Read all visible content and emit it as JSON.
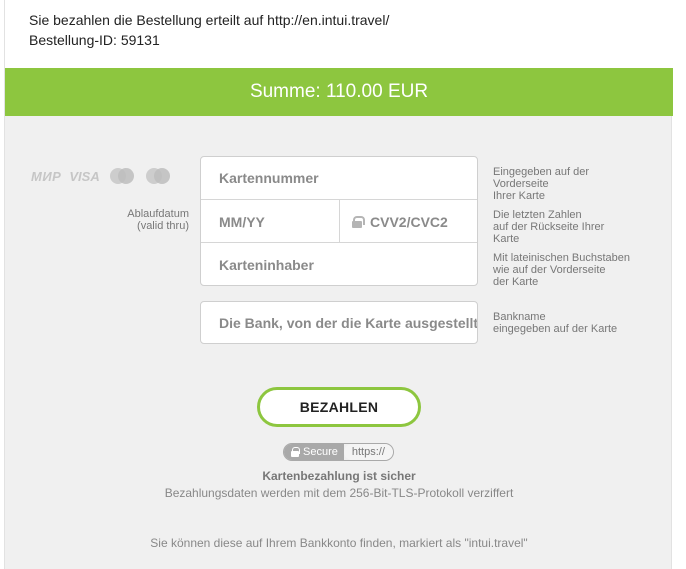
{
  "header": {
    "line1": "Sie bezahlen die Bestellung erteilt auf http://en.intui.travel/",
    "line2": "Bestellung-ID: 59131"
  },
  "total": {
    "label": "Summe: 110.00 EUR",
    "bar_color": "#8dc63f"
  },
  "card_logos": {
    "mir": "МИР",
    "visa": "VISA",
    "icons": [
      "mastercard-icon",
      "maestro-icon"
    ]
  },
  "expiry_label": {
    "line1": "Ablaufdatum",
    "line2": "(valid thru)"
  },
  "form": {
    "card_number_placeholder": "Kartennummer",
    "expiry_placeholder": "MM/YY",
    "cvv_placeholder": "CVV2/CVC2",
    "holder_placeholder": "Karteninhaber",
    "bank_placeholder": "Die Bank, von der die Karte ausgestellt wurde"
  },
  "hints": {
    "card_number": [
      "Eingegeben auf der",
      "Vorderseite",
      "Ihrer Karte"
    ],
    "cvv": [
      "Die letzten Zahlen",
      "auf der Rückseite Ihrer",
      "Karte"
    ],
    "holder": [
      "Mit lateinischen Buchstaben",
      "wie auf der Vorderseite",
      "der Karte"
    ],
    "bank": [
      "Bankname",
      "eingegeben auf der Karte"
    ]
  },
  "pay_button": "BEZAHLEN",
  "secure_badge": {
    "left": "Secure",
    "right": "https://"
  },
  "security": {
    "title": "Kartenbezahlung ist sicher",
    "subtitle": "Bezahlungsdaten werden mit dem 256-Bit-TLS-Protokoll verziffert"
  },
  "footer": "Sie können diese auf Ihrem Bankkonto finden, markiert als \"intui.travel\""
}
